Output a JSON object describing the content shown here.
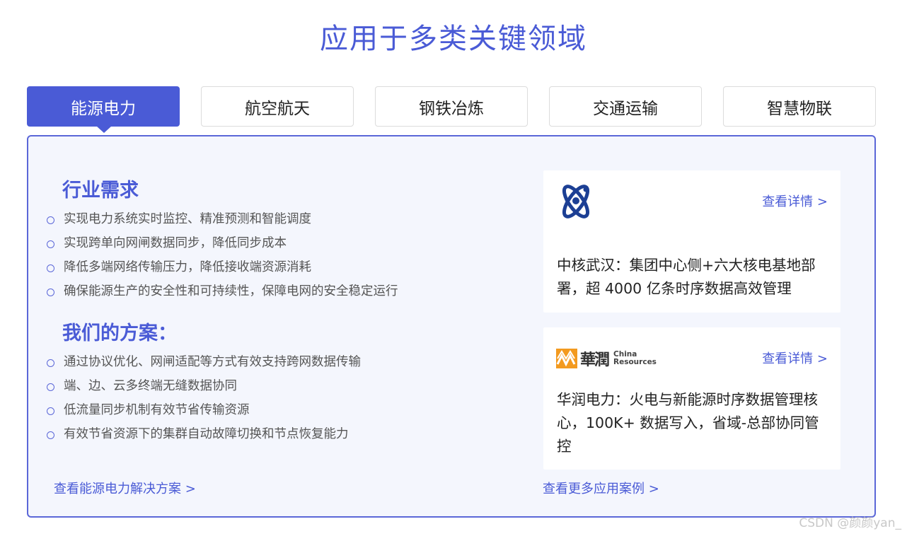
{
  "page_title": "应用于多类关键领域",
  "tabs": [
    {
      "label": "能源电力",
      "active": true
    },
    {
      "label": "航空航天",
      "active": false
    },
    {
      "label": "钢铁冶炼",
      "active": false
    },
    {
      "label": "交通运输",
      "active": false
    },
    {
      "label": "智慧物联",
      "active": false
    }
  ],
  "needs": {
    "title": "行业需求",
    "items": [
      "实现电力系统实时监控、精准预测和智能调度",
      "实现跨单向网闸数据同步，降低同步成本",
      "降低多端网络传输压力，降低接收端资源消耗",
      "确保能源生产的安全性和可持续性，保障电网的安全稳定运行"
    ]
  },
  "solution": {
    "title": "我们的方案：",
    "items": [
      "通过协议优化、网闸适配等方式有效支持跨网数据传输",
      "端、边、云多终端无缝数据协同",
      "低流量同步机制有效节省传输资源",
      "有效节省资源下的集群自动故障切换和节点恢复能力"
    ]
  },
  "solution_link": "查看能源电力解决方案 >",
  "more_cases_link": "查看更多应用案例 >",
  "cards": [
    {
      "logo_icon": "atom-logo-icon",
      "detail_link": "查看详情 >",
      "text": "中核武汉：集团中心侧+六大核电基地部署，超 4000 亿条时序数据高效管理"
    },
    {
      "logo_icon": "china-resources-logo-icon",
      "logo_han": "華潤",
      "logo_en_1": "China",
      "logo_en_2": "Resources",
      "detail_link": "查看详情 >",
      "text": "华润电力：火电与新能源时序数据管理核心，100K+ 数据写入，省域-总部协同管控"
    }
  ],
  "watermark": "CSDN @颜颜yan_",
  "colors": {
    "accent": "#4a5bd6",
    "panel_bg": "#f4f6fd",
    "border": "#5b67d8"
  }
}
